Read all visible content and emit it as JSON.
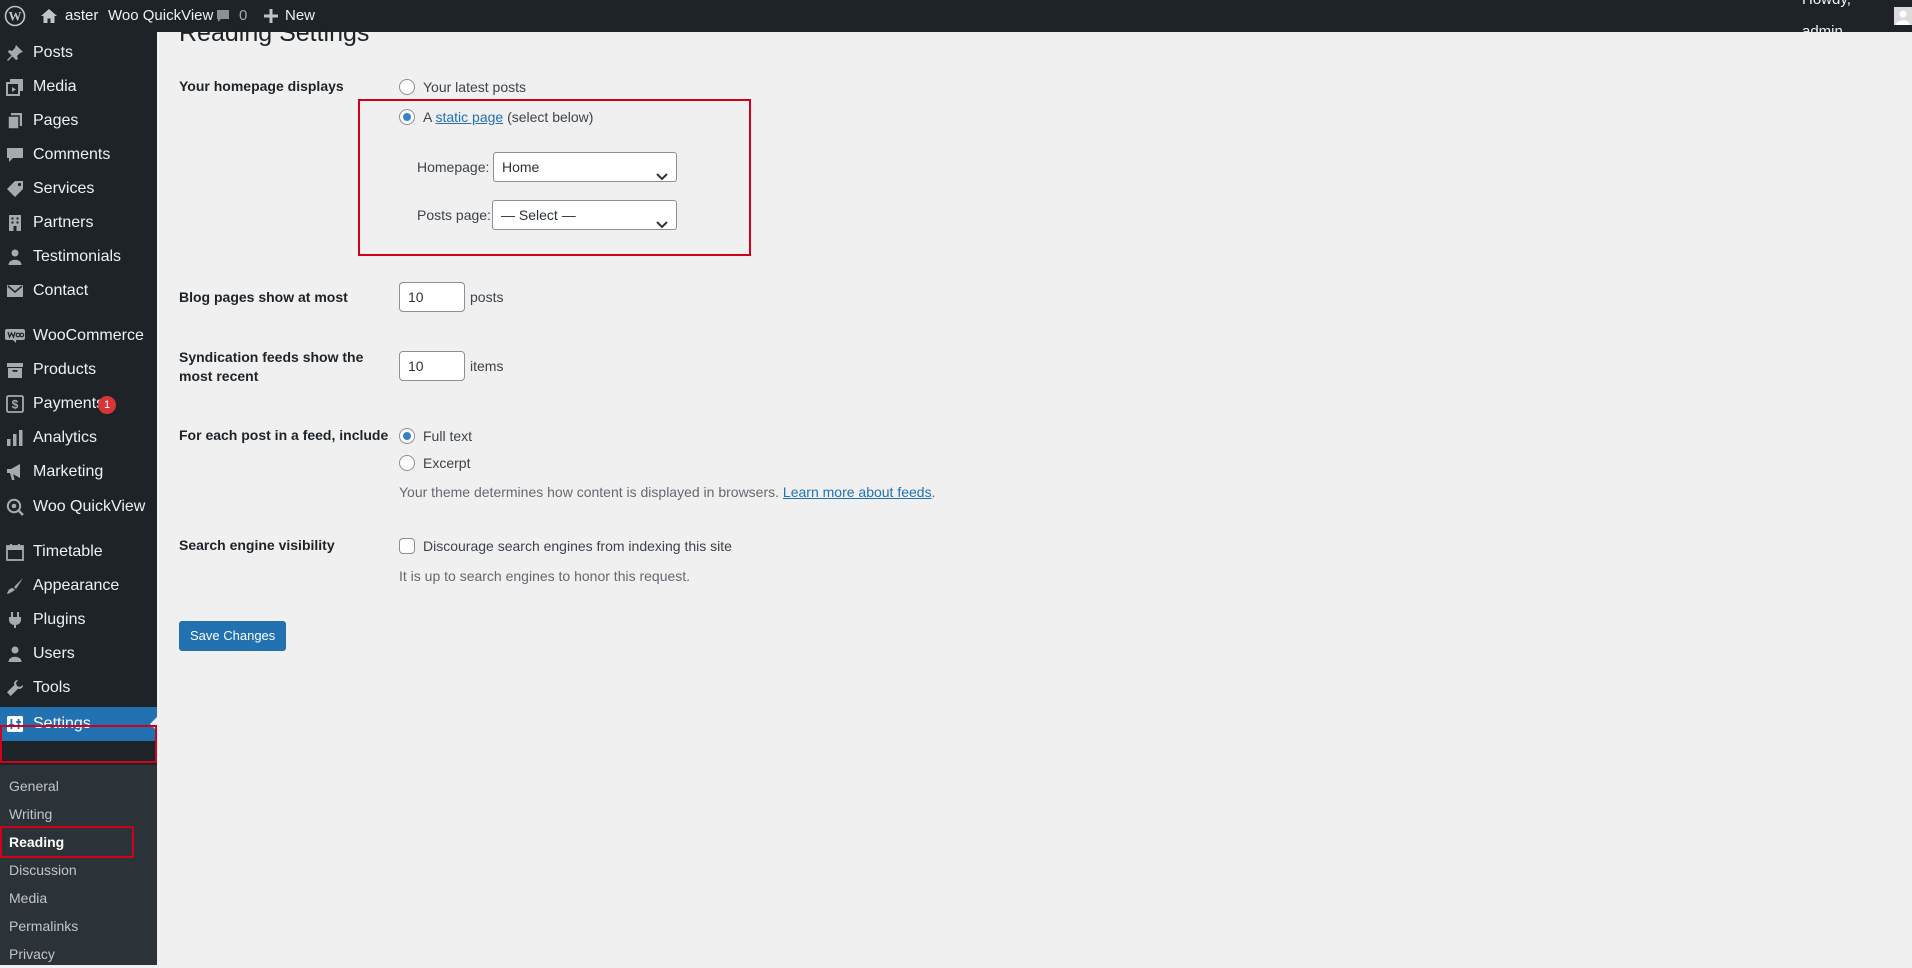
{
  "adminbar": {
    "site_name": "aster",
    "plugin_link": "Woo QuickView",
    "comments_count": "0",
    "new_label": "New",
    "howdy": "Howdy, admin"
  },
  "sidebar": {
    "items": [
      {
        "label": "Posts",
        "icon": "pin-icon"
      },
      {
        "label": "Media",
        "icon": "media-icon"
      },
      {
        "label": "Pages",
        "icon": "pages-icon"
      },
      {
        "label": "Comments",
        "icon": "comments-icon"
      },
      {
        "label": "Services",
        "icon": "tag-icon"
      },
      {
        "label": "Partners",
        "icon": "building-icon"
      },
      {
        "label": "Testimonials",
        "icon": "person-icon"
      },
      {
        "label": "Contact",
        "icon": "mail-icon"
      },
      {
        "label": "WooCommerce",
        "icon": "woo-icon"
      },
      {
        "label": "Products",
        "icon": "archive-icon"
      },
      {
        "label": "Payments",
        "icon": "dollar-icon",
        "badge": "1"
      },
      {
        "label": "Analytics",
        "icon": "bar-chart-icon"
      },
      {
        "label": "Marketing",
        "icon": "megaphone-icon"
      },
      {
        "label": "Woo QuickView",
        "icon": "magnifier-eye-icon"
      },
      {
        "label": "Timetable",
        "icon": "calendar-icon"
      },
      {
        "label": "Appearance",
        "icon": "brush-icon"
      },
      {
        "label": "Plugins",
        "icon": "plug-icon"
      },
      {
        "label": "Users",
        "icon": "users-icon"
      },
      {
        "label": "Tools",
        "icon": "wrench-icon"
      },
      {
        "label": "Settings",
        "icon": "settings-icon",
        "current": true
      }
    ],
    "submenu": [
      {
        "label": "General"
      },
      {
        "label": "Writing"
      },
      {
        "label": "Reading",
        "active": true
      },
      {
        "label": "Discussion"
      },
      {
        "label": "Media"
      },
      {
        "label": "Permalinks"
      },
      {
        "label": "Privacy"
      }
    ]
  },
  "page": {
    "title": "Reading Settings",
    "homepage_displays": {
      "label": "Your homepage displays",
      "option_latest": "Your latest posts",
      "option_static_prefix": "A",
      "option_static_link": "static page",
      "option_static_suffix": "(select below)",
      "selected": "static",
      "homepage_label": "Homepage:",
      "homepage_value": "Home",
      "posts_page_label": "Posts page:",
      "posts_page_value": "— Select —"
    },
    "blog_pages": {
      "label": "Blog pages show at most",
      "value": "10",
      "unit": "posts"
    },
    "syndication": {
      "label_line1": "Syndication feeds show the",
      "label_line2": "most recent",
      "value": "10",
      "unit": "items"
    },
    "feed_content": {
      "label": "For each post in a feed, include",
      "option_full": "Full text",
      "option_excerpt": "Excerpt",
      "selected": "full",
      "desc_prefix": "Your theme determines how content is displayed in browsers.",
      "desc_link": "Learn more about feeds",
      "desc_suffix": "."
    },
    "search_visibility": {
      "label": "Search engine visibility",
      "checkbox_label": "Discourage search engines from indexing this site",
      "checked": false,
      "desc": "It is up to search engines to honor this request."
    },
    "save_button": "Save Changes"
  },
  "colors": {
    "admin_bar_bg": "#1d2327",
    "menu_current_bg": "#2271b1",
    "submenu_bg": "#2c3338",
    "highlight_border": "#d0021b",
    "badge_bg": "#d63638",
    "page_bg": "#f0f0f1"
  }
}
